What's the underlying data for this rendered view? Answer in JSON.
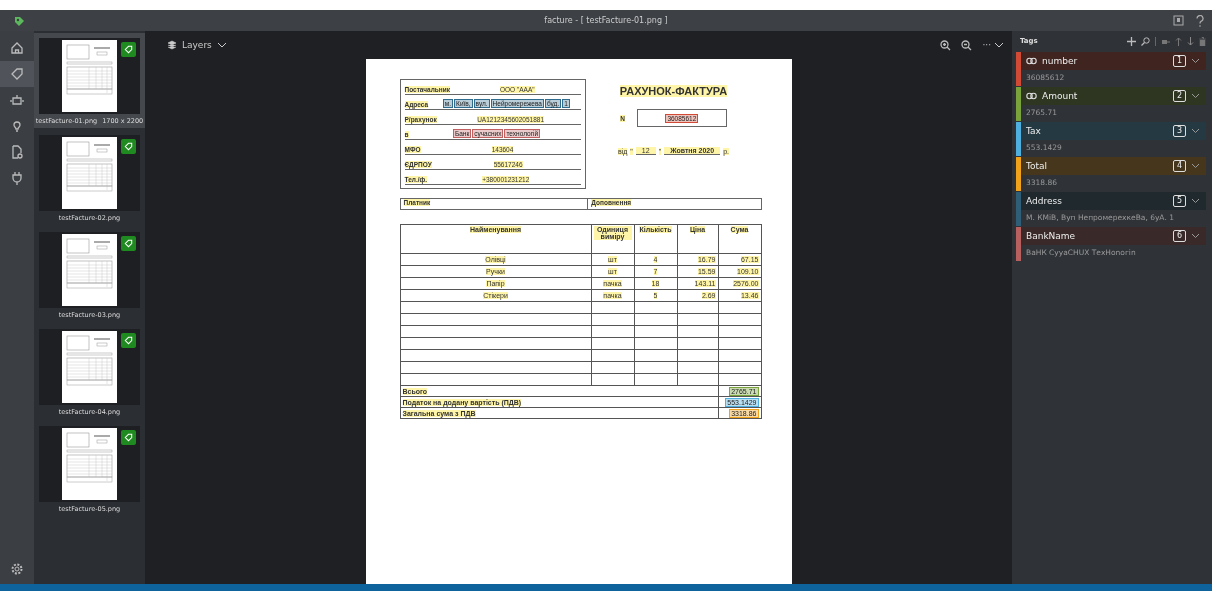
{
  "window": {
    "title": "facture - [ testFacture-01.png ]"
  },
  "rail": [
    {
      "kind": "home",
      "selected": false
    },
    {
      "kind": "tag",
      "selected": true
    },
    {
      "kind": "robot",
      "selected": false
    },
    {
      "kind": "bulb",
      "selected": false
    },
    {
      "kind": "doc",
      "selected": false
    },
    {
      "kind": "plug",
      "selected": false
    }
  ],
  "thumbnails": [
    {
      "label": "testFacture-01.png",
      "size": "1700 x 2200",
      "selected": true
    },
    {
      "label": "testFacture-02.png",
      "selected": false
    },
    {
      "label": "testFacture-03.png",
      "selected": false
    },
    {
      "label": "testFacture-04.png",
      "selected": false
    },
    {
      "label": "testFacture-05.png",
      "selected": false
    }
  ],
  "canvas_toolbar": {
    "layers": "Layers",
    "more": "···"
  },
  "document": {
    "supplier": [
      {
        "label": "Постачальник",
        "value": "ООО \"ААА\""
      },
      {
        "label": "Адреса",
        "words": [
          "м.",
          "Київ,",
          "вул.",
          "Нейромережева",
          "буд.",
          "1"
        ],
        "color": "#2f6b8c"
      },
      {
        "label": "Р/рахунок",
        "value": "UA1212345602051881"
      },
      {
        "label": "в",
        "words": [
          "Банк",
          "сучасних",
          "технологій"
        ],
        "color": "#c06060"
      },
      {
        "label": "МФО",
        "value": "143604"
      },
      {
        "label": "ЄДРПОУ",
        "value": "55617246"
      },
      {
        "label": "Тел./ф.",
        "value": "+380001231212"
      }
    ],
    "title": "РАХУНОК-ФАКТУРА",
    "number_label": "N",
    "number": {
      "text": "36085612",
      "color": "#d04a35"
    },
    "date": [
      "від",
      "\"",
      "12",
      "\"",
      "Жовтня 2020",
      "р."
    ],
    "payer": "Платник",
    "supplement": "Доповнення",
    "columns": [
      "Найменування",
      "Одиниця виміру",
      "Кількість",
      "Ціна",
      "Сума"
    ],
    "rows": [
      [
        "Олівці",
        "шт",
        "4",
        "16.79",
        "67.15"
      ],
      [
        "Ручки",
        "шт",
        "7",
        "15.59",
        "109.10"
      ],
      [
        "Папір",
        "пачка",
        "18",
        "143.11",
        "2576.00"
      ],
      [
        "Стікери",
        "пачка",
        "5",
        "2.69",
        "13.46"
      ]
    ],
    "totals": [
      {
        "label": "Всього",
        "value": "2765.71",
        "color": "#7aa33c"
      },
      {
        "label": "Податок на додану вартість (ПДВ)",
        "value": "553.1429",
        "color": "#4fb0e0"
      },
      {
        "label": "Загальна сума з ПДВ",
        "value": "3318.86",
        "color": "#f0a21b"
      }
    ]
  },
  "tags_panel": {
    "title": "Tags",
    "tags": [
      {
        "name": "number",
        "linked": true,
        "hotkey": "1",
        "value": "36085612",
        "color": "#d04a35"
      },
      {
        "name": "Amount",
        "linked": true,
        "hotkey": "2",
        "value": "2765.71",
        "color": "#7aa33c"
      },
      {
        "name": "Tax",
        "linked": false,
        "hotkey": "3",
        "value": "553.1429",
        "color": "#4fb0e0"
      },
      {
        "name": "Total",
        "linked": false,
        "hotkey": "4",
        "value": "3318.86",
        "color": "#f0a21b"
      },
      {
        "name": "Address",
        "linked": false,
        "hotkey": "5",
        "value": "М. КМіВ, Вуп НепромерехкеВа, 6уА. 1",
        "color": "#2f5f78"
      },
      {
        "name": "BankName",
        "linked": false,
        "hotkey": "6",
        "value": "ВаНК СууаСНUХ ТехНоnогin",
        "color": "#b86060"
      }
    ]
  }
}
